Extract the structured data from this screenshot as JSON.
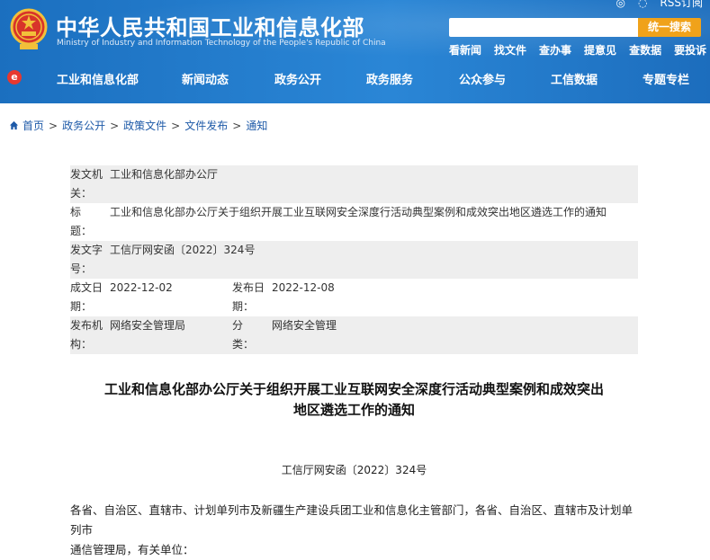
{
  "header": {
    "title": "中华人民共和国工业和信息化部",
    "subtitle": "Ministry of Industry and Information Technology of the People's Republic of China",
    "rss_label": "RSS订阅",
    "search_placeholder": "",
    "search_button": "统一搜索",
    "quick_links": [
      "看新闻",
      "找文件",
      "查办事",
      "提意见",
      "查数据",
      "要投诉"
    ],
    "brand_color": "#1b6fbf",
    "accent_color": "#f0a21a"
  },
  "nav": {
    "items": [
      "工业和信息化部",
      "新闻动态",
      "政务公开",
      "政务服务",
      "公众参与",
      "工信数据",
      "专题专栏"
    ]
  },
  "breadcrumb": [
    "首页",
    "政务公开",
    "政策文件",
    "文件发布",
    "通知"
  ],
  "meta": {
    "issuer_label": "发文机关：",
    "issuer": "工业和信息化部办公厅",
    "title_label": "标　　题：",
    "title": "工业和信息化部办公厅关于组织开展工业互联网安全深度行活动典型案例和成效突出地区遴选工作的通知",
    "docnum_label": "发文字号：",
    "docnum": "工信厅网安函〔2022〕324号",
    "written_label": "成文日期：",
    "written": "2022-12-02",
    "published_label": "发布日期：",
    "published": "2022-12-08",
    "agency_label": "发布机构：",
    "agency": "网络安全管理局",
    "category_label": "分　　类：",
    "category": "网络安全管理"
  },
  "document": {
    "title_line1": "工业和信息化部办公厅关于组织开展工业互联网安全深度行活动典型案例和成效突出",
    "title_line2": "地区遴选工作的通知",
    "number": "工信厅网安函〔2022〕324号",
    "salutation_line1": "各省、自治区、直辖市、计划单列市及新疆生产建设兵团工业和信息化主管部门，各省、自治区、直辖市及计划单列市",
    "salutation_line2": "通信管理局，有关单位："
  }
}
